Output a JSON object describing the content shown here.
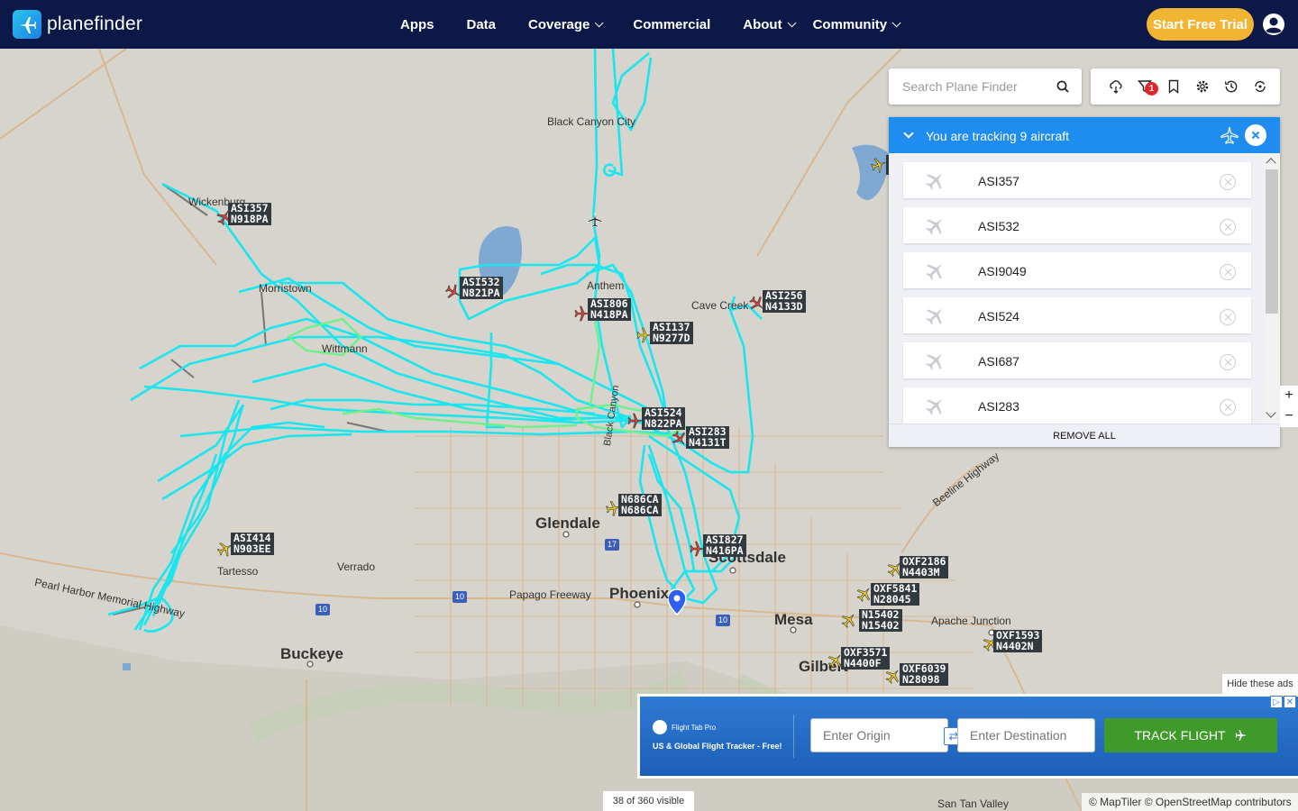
{
  "brand": {
    "name": "planefinder"
  },
  "nav": {
    "items": [
      {
        "label": "Apps",
        "has_menu": false
      },
      {
        "label": "Data",
        "has_menu": false
      },
      {
        "label": "Coverage",
        "has_menu": true
      },
      {
        "label": "Commercial",
        "has_menu": false
      },
      {
        "label": "About",
        "has_menu": true
      },
      {
        "label": "Community",
        "has_menu": true
      }
    ],
    "trial_button": "Start Free Trial"
  },
  "search": {
    "placeholder": "Search Plane Finder"
  },
  "toolbar": {
    "filter_badge": "1",
    "icons": [
      "weather-icon",
      "filter-icon",
      "bookmark-icon",
      "settings-icon",
      "history-icon",
      "playback-icon"
    ]
  },
  "tracking": {
    "title": "You are tracking 9 aircraft",
    "items": [
      "ASI357",
      "ASI532",
      "ASI9049",
      "ASI524",
      "ASI687",
      "ASI283"
    ],
    "remove_all": "REMOVE ALL"
  },
  "map": {
    "cities": [
      {
        "name": "Black Canyon City",
        "size": "small"
      },
      {
        "name": "Wickenburg",
        "size": "small"
      },
      {
        "name": "Morristown",
        "size": "small"
      },
      {
        "name": "Wittmann",
        "size": "small"
      },
      {
        "name": "Anthem",
        "size": "small"
      },
      {
        "name": "Cave Creek",
        "size": "small"
      },
      {
        "name": "Glendale",
        "size": "big"
      },
      {
        "name": "Phoenix",
        "size": "big"
      },
      {
        "name": "Scottsdale",
        "size": "big"
      },
      {
        "name": "Mesa",
        "size": "big"
      },
      {
        "name": "Gilbert",
        "size": "big"
      },
      {
        "name": "Buckeye",
        "size": "big"
      },
      {
        "name": "Tartesso",
        "size": "small"
      },
      {
        "name": "Verrado",
        "size": "small"
      },
      {
        "name": "Papago Freeway",
        "size": "small"
      },
      {
        "name": "Pearl Harbor Memorial Highway",
        "size": "small"
      },
      {
        "name": "Apache Junction",
        "size": "small"
      },
      {
        "name": "Beeline Highway",
        "size": "small"
      },
      {
        "name": "San Tan Valley",
        "size": "small"
      },
      {
        "name": "Black Canyon",
        "size": "small"
      }
    ],
    "aircraft": [
      {
        "callsign": "ASI357",
        "reg": "N918PA",
        "color": "#d8433a"
      },
      {
        "callsign": "ASI532",
        "reg": "N821PA",
        "color": "#d8433a"
      },
      {
        "callsign": "ASI806",
        "reg": "N418PA",
        "color": "#d8433a"
      },
      {
        "callsign": "ASI137",
        "reg": "N9277D",
        "color": "#f0d020"
      },
      {
        "callsign": "ASI256",
        "reg": "N4133D",
        "color": "#d8433a"
      },
      {
        "callsign": "ASI524",
        "reg": "N822PA",
        "color": "#d8433a"
      },
      {
        "callsign": "ASI283",
        "reg": "N4131T",
        "color": "#d8433a"
      },
      {
        "callsign": "N686CA",
        "reg": "N686CA",
        "color": "#f0d020"
      },
      {
        "callsign": "ASI414",
        "reg": "N903EE",
        "color": "#f0d020"
      },
      {
        "callsign": "ASI827",
        "reg": "N416PA",
        "color": "#d8433a"
      },
      {
        "callsign": "OXF2186",
        "reg": "N4403M",
        "color": "#f0d020"
      },
      {
        "callsign": "OXF5841",
        "reg": "N28045",
        "color": "#f0d020"
      },
      {
        "callsign": "N15402",
        "reg": "N15402",
        "color": "#f0d020"
      },
      {
        "callsign": "OXF1593",
        "reg": "N4402N",
        "color": "#f0d020"
      },
      {
        "callsign": "OXF3571",
        "reg": "N4400F",
        "color": "#f0d020"
      },
      {
        "callsign": "OXF6039",
        "reg": "N28098",
        "color": "#f0d020"
      }
    ],
    "highways": [
      "17",
      "10",
      "10",
      "10"
    ],
    "zoom_in": "+",
    "zoom_out": "−"
  },
  "ad": {
    "hide": "Hide these ads",
    "brand": "Flight Tab Pro",
    "tagline": "US & Global Flight Tracker - Free!",
    "origin_placeholder": "Enter Origin",
    "destination_placeholder": "Enter Destination",
    "button": "TRACK FLIGHT"
  },
  "status": {
    "visible": "38 of 360 visible",
    "attribution": "© MapTiler © OpenStreetMap contributors"
  }
}
